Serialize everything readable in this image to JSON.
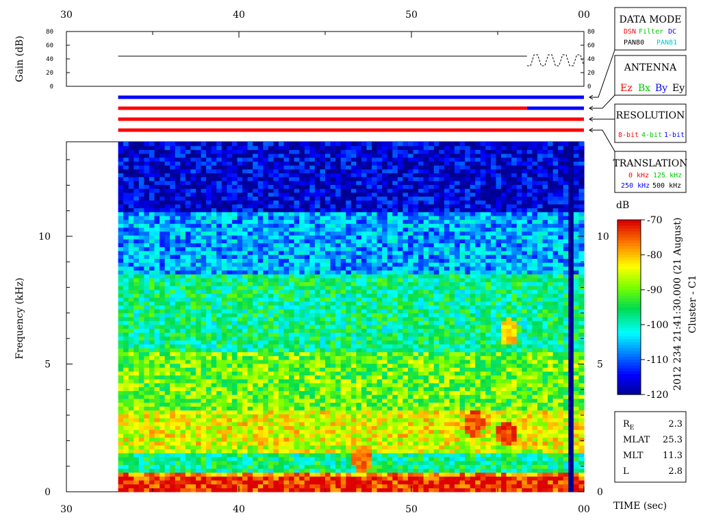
{
  "chart_data": {
    "type": "heatmap",
    "title": "",
    "time_axis": {
      "label": "TIME (sec)",
      "tick_labels": [
        "30",
        "40",
        "50",
        "00"
      ],
      "range": [
        30,
        60
      ],
      "data_start": 33,
      "data_end": 60,
      "segment_change": 56.7
    },
    "frequency_axis": {
      "label": "Frequency (kHz)",
      "ticks": [
        0,
        5,
        10
      ],
      "range": [
        0,
        13.7
      ]
    },
    "gain_panel": {
      "ylabel": "Gain (dB)",
      "ticks": [
        0,
        20,
        40,
        60,
        80
      ],
      "range": [
        0,
        80
      ],
      "level": 44,
      "switch_time": 56.7,
      "alt_levels": [
        30,
        46
      ]
    },
    "status_bars": [
      {
        "name": "data_mode",
        "color": "#0000ff"
      },
      {
        "name": "antenna",
        "segments": [
          {
            "from": 33,
            "to": 56.7,
            "color": "#ff0000"
          },
          {
            "from": 56.7,
            "to": 60,
            "color": "#0000ff"
          }
        ]
      },
      {
        "name": "resolution",
        "color": "#ff0000"
      },
      {
        "name": "translation",
        "color": "#ff0000"
      }
    ],
    "colorbar": {
      "label": "dB",
      "ticks": [
        -70,
        -80,
        -90,
        -100,
        -110,
        -120
      ],
      "range": [
        -120,
        -70
      ]
    },
    "spectrogram_bands": [
      {
        "f_from": 0,
        "f_to": 0.6,
        "db": -72
      },
      {
        "f_from": 0.6,
        "f_to": 0.8,
        "db": -78
      },
      {
        "f_from": 0.8,
        "f_to": 1.55,
        "db": -97
      },
      {
        "f_from": 1.55,
        "f_to": 1.8,
        "db": -85
      },
      {
        "f_from": 1.8,
        "f_to": 3.2,
        "db": -84
      },
      {
        "f_from": 3.2,
        "f_to": 5.5,
        "db": -90
      },
      {
        "f_from": 5.5,
        "f_to": 8.5,
        "db": -97
      },
      {
        "f_from": 8.5,
        "f_to": 11,
        "db": -106
      },
      {
        "f_from": 11,
        "f_to": 13.7,
        "db": -116
      }
    ],
    "bright_features": [
      {
        "t": 53.5,
        "f": 2.6,
        "db": -74
      },
      {
        "t": 55.3,
        "f": 2.2,
        "db": -73
      },
      {
        "t": 47.0,
        "f": 1.2,
        "db": -76
      },
      {
        "t": 55.5,
        "f": 6.2,
        "db": -80
      }
    ]
  },
  "panels": {
    "data_mode": {
      "title": "DATA MODE",
      "row1": [
        "DSN",
        "Filter",
        "DC"
      ],
      "row2": [
        "PAN80",
        "PAN81"
      ]
    },
    "antenna": {
      "title": "ANTENNA",
      "items": [
        "Ez",
        "Bx",
        "By",
        "Ey"
      ]
    },
    "resolution": {
      "title": "RESOLUTION",
      "items": [
        "8-bit",
        "4-bit",
        "1-bit"
      ]
    },
    "translation": {
      "title": "TRANSLATION",
      "row1": [
        "0 kHz",
        "125 kHz"
      ],
      "row2": [
        "250 kHz",
        "500 kHz"
      ]
    }
  },
  "side_label": {
    "line1": "2012 234 21:41:30.000 (21 August)",
    "line2": "Cluster - C1"
  },
  "info_box": {
    "rows": [
      {
        "label": "R",
        "sub": "E",
        "value": "2.3"
      },
      {
        "label": "MLAT",
        "sub": "",
        "value": "25.3"
      },
      {
        "label": "MLT",
        "sub": "",
        "value": "11.3"
      },
      {
        "label": "L",
        "sub": "",
        "value": "2.8"
      }
    ]
  },
  "colors": {
    "red": "#ff0000",
    "green": "#00c800",
    "blue": "#0000ff",
    "black": "#000000",
    "cyan": "#00c8c8"
  }
}
